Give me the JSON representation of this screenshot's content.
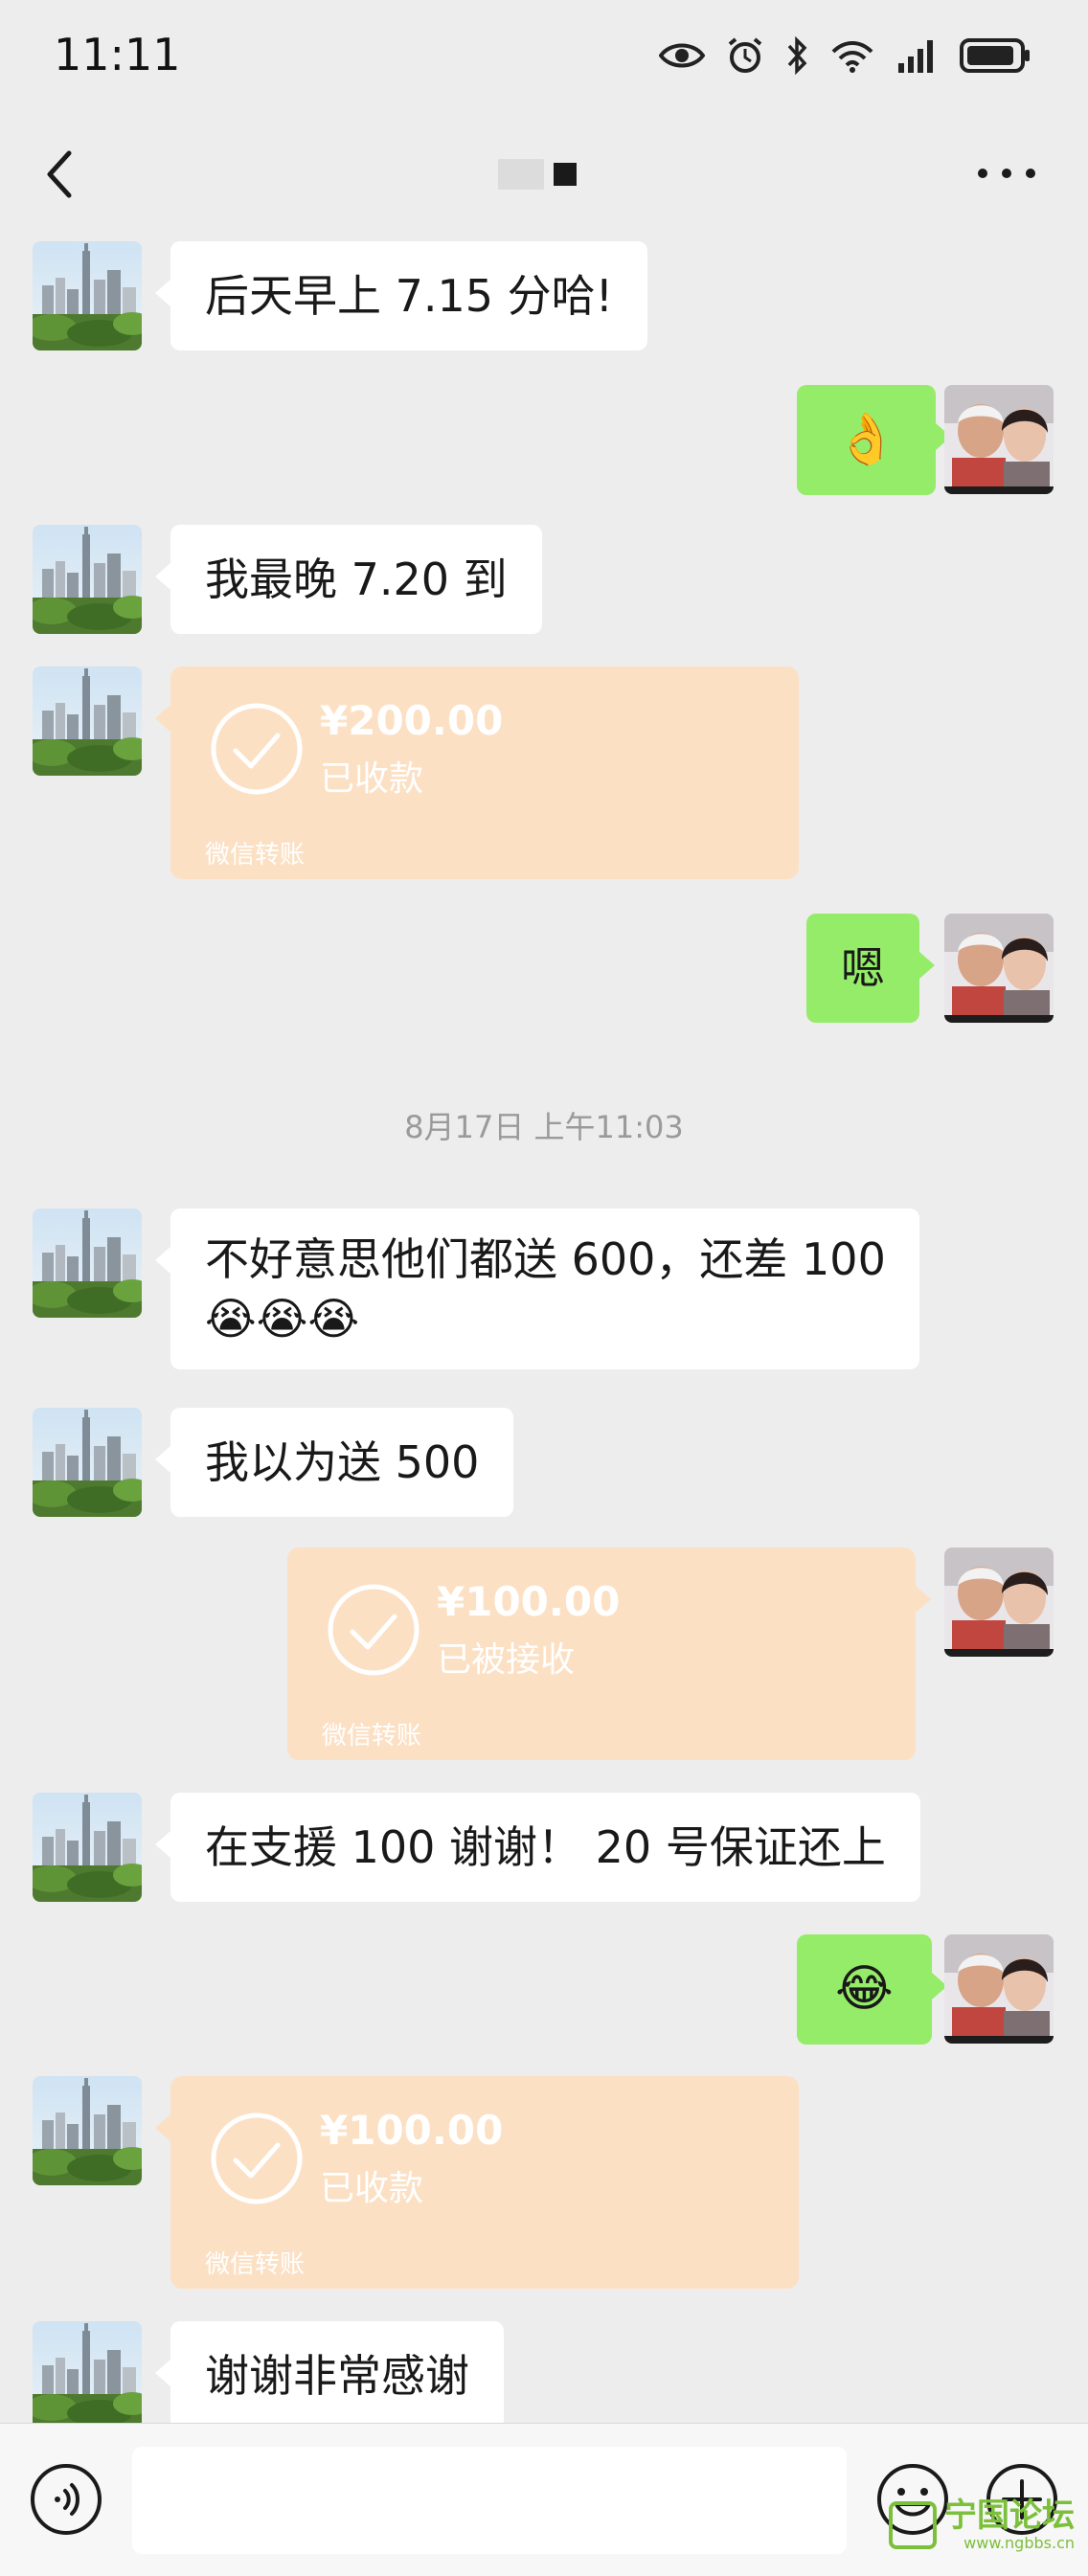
{
  "status_bar": {
    "time": "11:11",
    "icons": [
      "eye-icon",
      "alarm-icon",
      "bluetooth-icon",
      "wifi-icon",
      "signal-icon",
      "battery-icon"
    ]
  },
  "header": {
    "title": ""
  },
  "messages": [
    {
      "type": "text",
      "side": "in",
      "text": "后天早上 7.15 分哈!"
    },
    {
      "type": "emoji",
      "side": "out",
      "text": "👌"
    },
    {
      "type": "text",
      "side": "in",
      "text": "我最晚 7.20 到"
    },
    {
      "type": "transfer",
      "side": "in",
      "amount": "¥200.00",
      "state": "已收款",
      "footer": "微信转账"
    },
    {
      "type": "text",
      "side": "out",
      "text": "嗯"
    },
    {
      "type": "timestamp",
      "text": "8月17日 上午11:03"
    },
    {
      "type": "text",
      "side": "in",
      "line1": "不好意思他们都送 600，还差 100",
      "line2": "😭😭😭"
    },
    {
      "type": "text",
      "side": "in",
      "text": "我以为送 500"
    },
    {
      "type": "transfer",
      "side": "out",
      "amount": "¥100.00",
      "state": "已被接收",
      "footer": "微信转账"
    },
    {
      "type": "text",
      "side": "in",
      "text": "在支援 100 谢谢！ 20 号保证还上"
    },
    {
      "type": "emoji",
      "side": "out",
      "text": "😂"
    },
    {
      "type": "transfer",
      "side": "in",
      "amount": "¥100.00",
      "state": "已收款",
      "footer": "微信转账"
    },
    {
      "type": "text",
      "side": "in",
      "text": "谢谢非常感谢"
    }
  ],
  "input": {
    "placeholder": ""
  },
  "watermark": {
    "title": "宁国论坛",
    "url": "www.ngbbs.cn"
  },
  "colors": {
    "background": "#ededed",
    "outgoing_bubble": "#95ec69",
    "incoming_bubble": "#ffffff",
    "transfer_card": "#fce0c4",
    "watermark": "#7cbf3b"
  }
}
